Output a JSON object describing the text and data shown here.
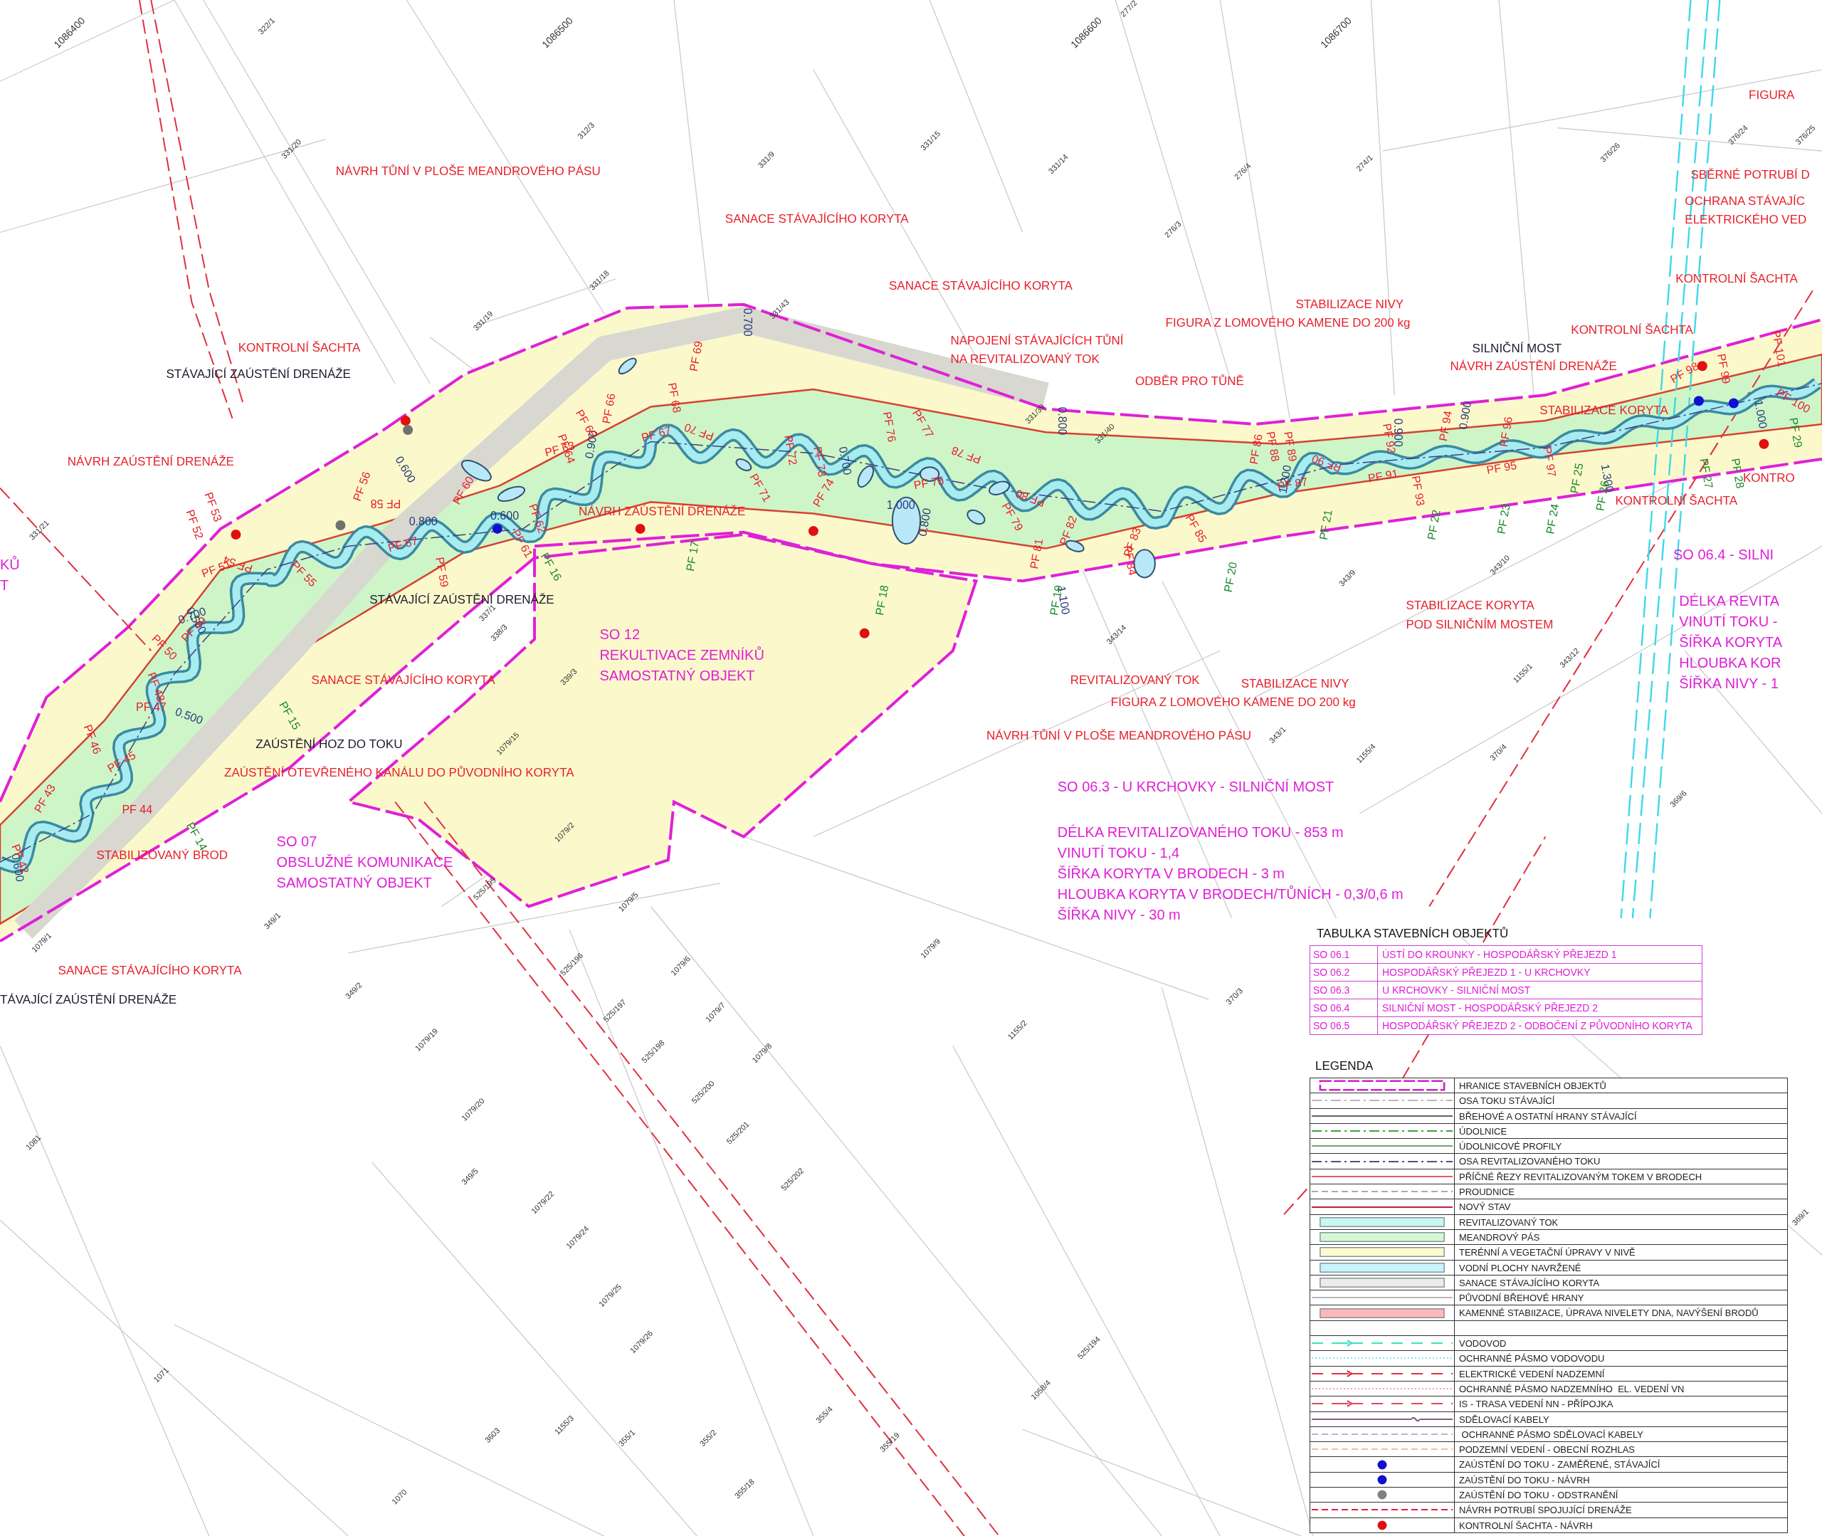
{
  "grid_coordinates": [
    "1086400",
    "1086500",
    "1086600",
    "1086700"
  ],
  "annotations": [
    {
      "kind": "red",
      "lines": [
        "NÁVRH TŮNÍ V PLOŠE MEANDROVÉHO PÁSU"
      ]
    },
    {
      "kind": "red",
      "lines": [
        "SANACE STÁVAJÍCÍHO KORYTA"
      ]
    },
    {
      "kind": "red",
      "lines": [
        "SANACE STÁVAJÍCÍHO KORYTA"
      ]
    },
    {
      "kind": "red",
      "lines": [
        "KONTROLNÍ ŠACHTA"
      ]
    },
    {
      "kind": "black",
      "lines": [
        "STÁVAJÍCÍ ZAÚSTĚNÍ DRENÁŽE"
      ]
    },
    {
      "kind": "red",
      "lines": [
        "NÁVRH ZAÚSTĚNÍ DRENÁŽE"
      ]
    },
    {
      "kind": "red",
      "lines": [
        "NAPOJENÍ STÁVAJÍCÍCH TŮNÍ",
        "NA REVITALIZOVANÝ TOK"
      ]
    },
    {
      "kind": "red",
      "lines": [
        "STABILIZACE NIVY"
      ]
    },
    {
      "kind": "red",
      "lines": [
        "FIGURA Z LOMOVÉHO KAMENE DO 200 kg"
      ]
    },
    {
      "kind": "red",
      "lines": [
        "ODBĚR PRO TŮNĚ"
      ]
    },
    {
      "kind": "black",
      "lines": [
        "SILNIČNÍ MOST"
      ]
    },
    {
      "kind": "red",
      "lines": [
        "NÁVRH ZAÚSTĚNÍ DRENÁŽE"
      ]
    },
    {
      "kind": "red",
      "lines": [
        "KONTROLNÍ ŠACHTA"
      ]
    },
    {
      "kind": "red",
      "lines": [
        "STABILIZACE KORYTA"
      ]
    },
    {
      "kind": "red",
      "lines": [
        "KONTROLNÍ ŠACHTA"
      ]
    },
    {
      "kind": "red",
      "lines": [
        "NÁVRH ZAÚSTĚNÍ DRENÁŽE"
      ]
    },
    {
      "kind": "black",
      "lines": [
        "STÁVAJÍCÍ ZAÚSTĚNÍ DRENÁŽE"
      ]
    },
    {
      "kind": "red",
      "lines": [
        "SANACE STÁVAJÍCÍHO KORYTA"
      ]
    },
    {
      "kind": "black",
      "lines": [
        "ZAÚSTĚNÍ HOZ DO TOKU"
      ]
    },
    {
      "kind": "red",
      "lines": [
        "ZAÚSTĚNÍ OTEVŘENÉHO KANÁLU DO PŮVODNÍHO KORYTA"
      ]
    },
    {
      "kind": "red",
      "lines": [
        "STABILIZOVANÝ BROD"
      ]
    },
    {
      "kind": "red",
      "lines": [
        "SANACE STÁVAJÍCÍHO KORYTA"
      ]
    },
    {
      "kind": "black",
      "lines": [
        "TÁVAJÍCÍ ZAÚSTĚNÍ DRENÁŽE"
      ]
    },
    {
      "kind": "red",
      "lines": [
        "STABILIZACE KORYTA",
        "POD SILNIČNÍM MOSTEM"
      ]
    },
    {
      "kind": "red",
      "lines": [
        "REVITALIZOVANÝ TOK"
      ]
    },
    {
      "kind": "red",
      "lines": [
        "STABILIZACE NIVY"
      ]
    },
    {
      "kind": "red",
      "lines": [
        "FIGURA Z LOMOVÉHO KAMENE DO 200 kg"
      ]
    },
    {
      "kind": "red",
      "lines": [
        "NÁVRH TŮNÍ V PLOŠE MEANDROVÉHO PÁSU"
      ]
    },
    {
      "kind": "red",
      "lines": [
        "FIGURA"
      ]
    },
    {
      "kind": "red",
      "lines": [
        "SBĚRNÉ POTRUBÍ D"
      ]
    },
    {
      "kind": "red",
      "lines": [
        "OCHRANA STÁVAJÍC",
        "ELEKTRICKÉHO VED"
      ]
    },
    {
      "kind": "red",
      "lines": [
        "KONTROLNÍ ŠACHTA"
      ]
    },
    {
      "kind": "red",
      "lines": [
        "KONTRO"
      ]
    },
    {
      "kind": "magenta",
      "lines": [
        "SO 12",
        "REKULTIVACE ZEMNÍKŮ",
        "SAMOSTATNÝ OBJEKT"
      ]
    },
    {
      "kind": "magenta",
      "lines": [
        "SO 07",
        "OBSLUŽNÉ KOMUNIKACE",
        "SAMOSTATNÝ OBJEKT"
      ]
    },
    {
      "kind": "magenta",
      "lines": [
        "SO 06.3 - U KRCHOVKY - SILNIČNÍ MOST"
      ]
    },
    {
      "kind": "magenta",
      "lines": [
        "DÉLKA REVITALIZOVANÉHO TOKU - 853 m",
        "VINUTÍ TOKU - 1,4",
        "ŠÍŘKA KORYTA V BRODECH - 3 m",
        "HLOUBKA KORYTA V BRODECH/TŮNÍCH  - 0,3/0,6 m",
        "ŠÍŘKA NIVY - 30 m"
      ]
    },
    {
      "kind": "magenta",
      "lines": [
        "SO 06.4 - SILNI"
      ]
    },
    {
      "kind": "magenta",
      "lines": [
        "DÉLKA REVITA",
        "VINUTÍ TOKU -",
        "ŠÍŘKA KORYTA",
        "HLOUBKA KOR",
        "ŠÍŘKA NIVY - 1"
      ]
    },
    {
      "kind": "magenta",
      "lines": [
        "KŮ",
        "T"
      ]
    }
  ],
  "profiles": [
    {
      "kind": "cross-section",
      "text": "PF 42"
    },
    {
      "kind": "cross-section",
      "text": "PF 43"
    },
    {
      "kind": "cross-section",
      "text": "PF 44"
    },
    {
      "kind": "cross-section",
      "text": "PF 45"
    },
    {
      "kind": "cross-section",
      "text": "PF 46"
    },
    {
      "kind": "cross-section",
      "text": "PF 47"
    },
    {
      "kind": "cross-section",
      "text": "PF 48"
    },
    {
      "kind": "cross-section",
      "text": "PF 49"
    },
    {
      "kind": "cross-section",
      "text": "PF 50"
    },
    {
      "kind": "cross-section",
      "text": "PF 51"
    },
    {
      "kind": "cross-section",
      "text": "PF 52"
    },
    {
      "kind": "cross-section",
      "text": "PF 53"
    },
    {
      "kind": "cross-section",
      "text": "PF 54"
    },
    {
      "kind": "cross-section",
      "text": "PF 55"
    },
    {
      "kind": "cross-section",
      "text": "PF 56"
    },
    {
      "kind": "cross-section",
      "text": "PF 57"
    },
    {
      "kind": "cross-section",
      "text": "PF 58"
    },
    {
      "kind": "cross-section",
      "text": "PF 59"
    },
    {
      "kind": "cross-section",
      "text": "PF 60"
    },
    {
      "kind": "cross-section",
      "text": "PF 61"
    },
    {
      "kind": "cross-section",
      "text": "PF 62"
    },
    {
      "kind": "cross-section",
      "text": "PF 63"
    },
    {
      "kind": "cross-section",
      "text": "PF 64"
    },
    {
      "kind": "cross-section",
      "text": "PF 65"
    },
    {
      "kind": "cross-section",
      "text": "PF 66"
    },
    {
      "kind": "cross-section",
      "text": "PF 67"
    },
    {
      "kind": "cross-section",
      "text": "PF 68"
    },
    {
      "kind": "cross-section",
      "text": "PF 69"
    },
    {
      "kind": "cross-section",
      "text": "PF 70"
    },
    {
      "kind": "cross-section",
      "text": "PF 71"
    },
    {
      "kind": "cross-section",
      "text": "PF 72"
    },
    {
      "kind": "cross-section",
      "text": "PF 73"
    },
    {
      "kind": "cross-section",
      "text": "PF 74"
    },
    {
      "kind": "cross-section",
      "text": "PF 75"
    },
    {
      "kind": "cross-section",
      "text": "PF 76"
    },
    {
      "kind": "cross-section",
      "text": "PF 77"
    },
    {
      "kind": "cross-section",
      "text": "PF 78"
    },
    {
      "kind": "cross-section",
      "text": "PF 79"
    },
    {
      "kind": "cross-section",
      "text": "PF 80"
    },
    {
      "kind": "cross-section",
      "text": "PF 81"
    },
    {
      "kind": "cross-section",
      "text": "PF 82"
    },
    {
      "kind": "cross-section",
      "text": "PF 83"
    },
    {
      "kind": "cross-section",
      "text": "PF 84"
    },
    {
      "kind": "cross-section",
      "text": "PF 85"
    },
    {
      "kind": "cross-section",
      "text": "PF 86"
    },
    {
      "kind": "cross-section",
      "text": "PF 87"
    },
    {
      "kind": "cross-section",
      "text": "PF 88"
    },
    {
      "kind": "cross-section",
      "text": "PF 89"
    },
    {
      "kind": "cross-section",
      "text": "PF 90"
    },
    {
      "kind": "cross-section",
      "text": "PF 91"
    },
    {
      "kind": "cross-section",
      "text": "PF 92"
    },
    {
      "kind": "cross-section",
      "text": "PF 93"
    },
    {
      "kind": "cross-section",
      "text": "PF 94"
    },
    {
      "kind": "cross-section",
      "text": "PF 95"
    },
    {
      "kind": "cross-section",
      "text": "PF 96"
    },
    {
      "kind": "cross-section",
      "text": "PF 97"
    },
    {
      "kind": "cross-section",
      "text": "PF 98"
    },
    {
      "kind": "cross-section",
      "text": "PF 99"
    },
    {
      "kind": "cross-section",
      "text": "PF 100"
    },
    {
      "kind": "cross-section",
      "text": "PF 101"
    },
    {
      "kind": "valley",
      "text": "PF 14"
    },
    {
      "kind": "valley",
      "text": "PF 15"
    },
    {
      "kind": "valley",
      "text": "PF 16"
    },
    {
      "kind": "valley",
      "text": "PF 17"
    },
    {
      "kind": "valley",
      "text": "PF 18"
    },
    {
      "kind": "valley",
      "text": "PF 19"
    },
    {
      "kind": "valley",
      "text": "PF 20"
    },
    {
      "kind": "valley",
      "text": "PF 21"
    },
    {
      "kind": "valley",
      "text": "PF 22"
    },
    {
      "kind": "valley",
      "text": "PF 23"
    },
    {
      "kind": "valley",
      "text": "PF 24"
    },
    {
      "kind": "valley",
      "text": "PF 25"
    },
    {
      "kind": "valley",
      "text": "PF 26"
    },
    {
      "kind": "valley",
      "text": "PF 27"
    },
    {
      "kind": "valley",
      "text": "PF 28"
    },
    {
      "kind": "valley",
      "text": "PF 29"
    }
  ],
  "depth_labels": [
    "0.600",
    "0.600",
    "0.600",
    "0.900",
    "0.700",
    "0.500",
    "0.500",
    "0.800",
    "0.700",
    "1.000",
    "0.700",
    "0.800",
    "1.100",
    "1.200",
    "0.900",
    "0.900",
    "1.300",
    "1.000",
    "0.800"
  ],
  "parcels": [
    "322/1",
    "331/20",
    "312/3",
    "331/15",
    "331/9",
    "331/14",
    "276/4",
    "274/1",
    "276/3",
    "277/2",
    "376/24",
    "376/25",
    "376/26",
    "331/18",
    "331/19",
    "331/21",
    "1079/1",
    "349/1",
    "349/2",
    "1079/5",
    "1079/6",
    "1079/7",
    "1079/8",
    "1079/9",
    "1079/19",
    "1079/20",
    "349/5",
    "1079/22",
    "1079/24",
    "1079/25",
    "1079/26",
    "1081",
    "1071",
    "3603",
    "1155/3",
    "355/1",
    "355/2",
    "355/4",
    "355/19",
    "355/18",
    "1070",
    "1155/2",
    "370/3",
    "369/6",
    "1155/1",
    "1155/4",
    "343/1",
    "370/4",
    "369/1",
    "1058/4",
    "525/194",
    "525/195",
    "525/196",
    "525/197",
    "525/198",
    "525/200",
    "525/201",
    "525/202",
    "343/9",
    "343/10",
    "343/12",
    "343/14",
    "331/39",
    "331/40",
    "331/43",
    "337/1",
    "338/3",
    "339/3",
    "1079/15",
    "1079/2"
  ],
  "objects_table": {
    "title": "TABULKA STAVEBNÍCH OBJEKTŮ",
    "rows": [
      {
        "code": "SO 06.1",
        "name": "ÚSTÍ DO KROUNKY - HOSPODÁŘSKÝ PŘEJEZD 1"
      },
      {
        "code": "SO 06.2",
        "name": "HOSPODÁŘSKÝ PŘEJEZD 1 - U KRCHOVKY"
      },
      {
        "code": "SO 06.3",
        "name": "U KRCHOVKY - SILNIČNÍ MOST"
      },
      {
        "code": "SO 06.4",
        "name": "SILNIČNÍ MOST - HOSPODÁŘSKÝ PŘEJEZD 2"
      },
      {
        "code": "SO 06.5",
        "name": "HOSPODÁŘSKÝ PŘEJEZD 2 - ODBOČENÍ Z PŮVODNÍHO KORYTA"
      }
    ]
  },
  "legend": {
    "title": "LEGENDA",
    "items": [
      {
        "kind": "boundary",
        "color": "#d020c8",
        "label": "HRANICE STAVEBNÍCH OBJEKTŮ"
      },
      {
        "kind": "dashdot",
        "color": "#b8b8b8",
        "label": "OSA TOKU STÁVAJÍCÍ"
      },
      {
        "kind": "solid",
        "color": "#606060",
        "label": "BŘEHOVÉ A OSTATNÍ HRANY STÁVAJÍCÍ"
      },
      {
        "kind": "dashdot",
        "color": "#40a040",
        "label": "ÚDOLNICE"
      },
      {
        "kind": "solid",
        "color": "#70a070",
        "label": "ÚDOLNICOVÉ PROFILY"
      },
      {
        "kind": "dashdot",
        "color": "#505088",
        "label": "OSA REVITALIZOVANÉHO TOKU"
      },
      {
        "kind": "solid",
        "color": "#e06070",
        "label": "PŘÍČNÉ ŘEZY REVITALIZOVANÝM TOKEM V BRODECH"
      },
      {
        "kind": "dashed",
        "color": "#a8a8b8",
        "label": "PROUDNICE"
      },
      {
        "kind": "solid",
        "color": "#c02040",
        "label": "NOVÝ STAV"
      },
      {
        "kind": "fill",
        "color": "#c8f8f0",
        "label": "REVITALIZOVANÝ TOK"
      },
      {
        "kind": "fill",
        "color": "#d4f8d4",
        "label": "MEANDROVÝ PÁS"
      },
      {
        "kind": "fill",
        "color": "#fcfcd0",
        "label": "TERÉNNÍ A VEGETAČNÍ ÚPRAVY V NIVĚ"
      },
      {
        "kind": "fill",
        "color": "#c8f4fc",
        "label": "VODNÍ PLOCHY NAVRŽENÉ"
      },
      {
        "kind": "fill",
        "color": "#ececec",
        "label": "SANACE STÁVAJÍCÍHO KORYTA"
      },
      {
        "kind": "solid",
        "color": "#b8b8b8",
        "label": "PŮVODNÍ BŘEHOVÉ HRANY"
      },
      {
        "kind": "fill",
        "color": "#fcb8b8",
        "label": "KAMENNÉ STABIIZACE, ÚPRAVA NIVELETY DNA, NAVÝŠENÍ BRODŮ"
      },
      {
        "kind": "blank"
      },
      {
        "kind": "arrowline",
        "color": "#40e0c0",
        "label": "VODOVOD"
      },
      {
        "kind": "dotted",
        "color": "#80e8f0",
        "label": "OCHRANNÉ PÁSMO VODOVODU"
      },
      {
        "kind": "arrowline",
        "color": "#e03040",
        "label": "ELEKTRICKÉ VEDENÍ NADZEMNÍ"
      },
      {
        "kind": "dotted",
        "color": "#f0a0b0",
        "label": "OCHRANNÉ PÁSMO NADZEMNÍHO  EL. VEDENÍ VN"
      },
      {
        "kind": "arrowline",
        "color": "#e04858",
        "label": "IS - TRASA VEDENÍ NN - PŘÍPOJKA"
      },
      {
        "kind": "cable",
        "color": "#806080",
        "label": "SDĚLOVACÍ KABELY"
      },
      {
        "kind": "dashed",
        "color": "#c8a8d8",
        "label": " OCHRANNÉ PÁSMO SDĚLOVACÍ KABELY"
      },
      {
        "kind": "dashed",
        "color": "#f0c090",
        "label": "PODZEMNÍ VEDENÍ - OBECNÍ ROZHLAS"
      },
      {
        "kind": "dot",
        "color": "#1010d0",
        "label": "ZAÚSTĚNÍ DO TOKU - ZAMĚŘENÉ, STÁVAJÍCÍ"
      },
      {
        "kind": "dot",
        "color": "#1010d0",
        "label": "ZAÚSTĚNÍ DO TOKU - NÁVRH"
      },
      {
        "kind": "dot",
        "color": "#808080",
        "label": "ZAÚSTĚNÍ DO TOKU - ODSTRANĚNÍ"
      },
      {
        "kind": "dashed",
        "color": "#e02040",
        "label": "NÁVRH POTRUBÍ SPOJUJÍCÍ DRENÁŽE"
      },
      {
        "kind": "dot",
        "color": "#e01010",
        "label": "KONTROLNÍ ŠACHTA - NÁVRH"
      }
    ]
  }
}
